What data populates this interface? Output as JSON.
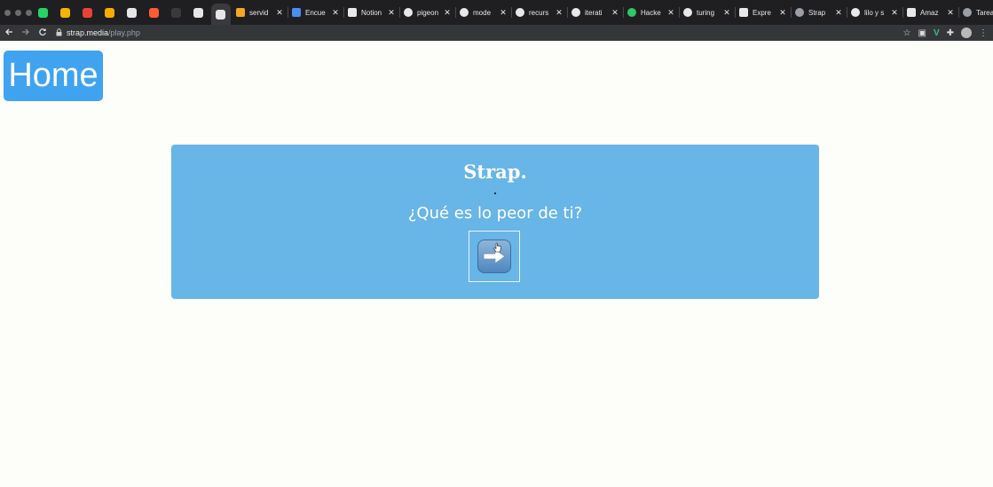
{
  "browser": {
    "pinned_tabs": [
      {
        "icon": "whatsapp-icon",
        "color": "#25d366"
      },
      {
        "icon": "google-drive-icon",
        "color": "#f4b400"
      },
      {
        "icon": "gmail-icon",
        "color": "#ea4335"
      },
      {
        "icon": "analytics-icon",
        "color": "#f9ab00"
      },
      {
        "icon": "trello-icon",
        "color": "#e6e6e6"
      },
      {
        "icon": "link-icon",
        "color": "#ff5a36"
      },
      {
        "icon": "blank-page-icon",
        "color": "#3a3a3e"
      },
      {
        "icon": "bookmark-icon",
        "color": "#e6e6e6"
      },
      {
        "icon": "strap-icon",
        "color": "#e6e6e6"
      }
    ],
    "tabs": [
      {
        "label": "servid",
        "icon": "chart-icon",
        "color": "#f5a623"
      },
      {
        "label": "Encue",
        "icon": "forms-icon",
        "color": "#4a8ef0"
      },
      {
        "label": "Notion",
        "icon": "notion-icon",
        "color": "#e8e8e8"
      },
      {
        "label": "pigeon",
        "icon": "google-icon",
        "color": "#e8e8e8"
      },
      {
        "label": "mode",
        "icon": "google-icon",
        "color": "#e8e8e8"
      },
      {
        "label": "recurs",
        "icon": "google-icon",
        "color": "#e8e8e8"
      },
      {
        "label": "iterati",
        "icon": "google-icon",
        "color": "#e8e8e8"
      },
      {
        "label": "Hacke",
        "icon": "hackerrank-icon",
        "color": "#2ec866"
      },
      {
        "label": "turing",
        "icon": "google-icon",
        "color": "#e8e8e8"
      },
      {
        "label": "Expre",
        "icon": "express-icon",
        "color": "#e8e8e8"
      },
      {
        "label": "Strap",
        "icon": "globe-icon",
        "color": "#9aa0a6"
      },
      {
        "label": "lilo y s",
        "icon": "google-icon",
        "color": "#e8e8e8"
      },
      {
        "label": "Amaz",
        "icon": "amazon-icon",
        "color": "#e8e8e8"
      },
      {
        "label": "Tarea",
        "icon": "globe-icon",
        "color": "#9aa0a6"
      }
    ],
    "close_glyph": "✕",
    "new_tab_glyph": "+",
    "url": {
      "host": "strap.media",
      "path": "/play.php"
    }
  },
  "page": {
    "home_label": "Home",
    "brand": "Strap.",
    "question": "¿Qué es lo peor de ti?",
    "colors": {
      "home_button": "#3fa3f0",
      "card": "#68b5e7",
      "background": "#fdfefa"
    }
  }
}
